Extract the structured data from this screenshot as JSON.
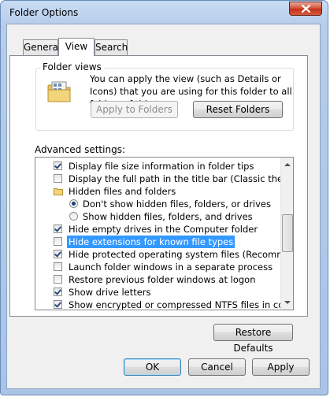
{
  "window": {
    "title": "Folder Options"
  },
  "tabs": [
    {
      "label": "General"
    },
    {
      "label": "View"
    },
    {
      "label": "Search"
    }
  ],
  "folder_views": {
    "label": "Folder views",
    "description": "You can apply the view (such as Details or Icons) that you are using for this folder to all folders of this type.",
    "apply_button": "Apply to Folders",
    "reset_button": "Reset Folders"
  },
  "advanced": {
    "label": "Advanced settings:",
    "items": [
      {
        "label": "Display file size information in folder tips",
        "control": "checkbox",
        "checked": true
      },
      {
        "label": "Display the full path in the title bar (Classic theme only)",
        "control": "checkbox",
        "checked": false
      },
      {
        "label": "Hidden files and folders",
        "control": "folder"
      },
      {
        "label": "Don't show hidden files, folders, or drives",
        "control": "radio",
        "checked": true
      },
      {
        "label": "Show hidden files, folders, and drives",
        "control": "radio",
        "checked": false
      },
      {
        "label": "Hide empty drives in the Computer folder",
        "control": "checkbox",
        "checked": true
      },
      {
        "label": "Hide extensions for known file types",
        "control": "checkbox",
        "checked": false,
        "selected": true
      },
      {
        "label": "Hide protected operating system files (Recommended)",
        "control": "checkbox",
        "checked": true
      },
      {
        "label": "Launch folder windows in a separate process",
        "control": "checkbox",
        "checked": false
      },
      {
        "label": "Restore previous folder windows at logon",
        "control": "checkbox",
        "checked": false
      },
      {
        "label": "Show drive letters",
        "control": "checkbox",
        "checked": true
      },
      {
        "label": "Show encrypted or compressed NTFS files in color",
        "control": "checkbox",
        "checked": true
      }
    ]
  },
  "restore_defaults_button": "Restore Defaults",
  "footer": {
    "ok": "OK",
    "cancel": "Cancel",
    "apply": "Apply"
  },
  "colors": {
    "selection": "#3399ff",
    "title_bar": "#b6cdeb",
    "close_button": "#c0301a"
  },
  "icons": [
    "close-icon",
    "folder-views-icon",
    "folder-icon",
    "scroll-up-icon",
    "scroll-down-icon"
  ]
}
